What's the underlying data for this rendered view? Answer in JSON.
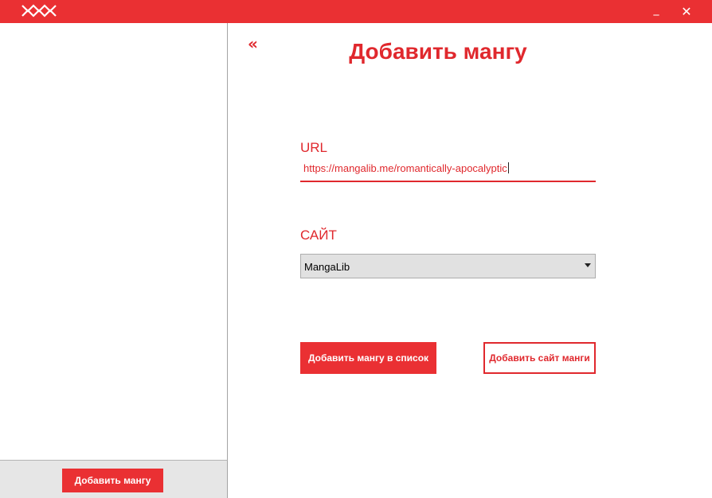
{
  "window": {
    "logo_icon": "zigzag-logo-icon",
    "minimize_glyph": "_",
    "close_glyph": "✕",
    "accent": "#ea3033"
  },
  "sidebar": {
    "add_manga_label": "Добавить мангу"
  },
  "main": {
    "back_glyph": "«",
    "title": "Добавить мангу",
    "url_label": "URL",
    "url_value": "https://mangalib.me/romantically-apocalyptic",
    "site_label": "САЙТ",
    "site_selected": "MangaLib",
    "add_to_list_label": "Добавить мангу в список",
    "add_site_label": "Добавить сайт манги"
  }
}
